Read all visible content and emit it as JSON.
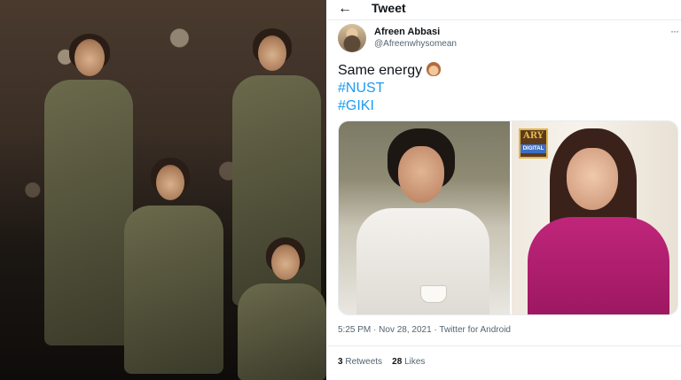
{
  "header": {
    "back_icon": "←",
    "title": "Tweet"
  },
  "author": {
    "display_name": "Afreen Abbasi",
    "handle": "@Afreenwhysomean"
  },
  "more_icon": "···",
  "tweet": {
    "text": "Same energy",
    "emoji": "see-no-evil-monkey",
    "hashtags": [
      "#NUST",
      "#GIKI"
    ]
  },
  "media": {
    "logo": {
      "line1": "ARY",
      "line2": "DIGITAL"
    }
  },
  "meta": {
    "time": "5:25 PM",
    "separator1": "·",
    "date": "Nov 28, 2021",
    "separator2": "·",
    "source": "Twitter for Android"
  },
  "stats": {
    "retweets_count": "3",
    "retweets_label": "Retweets",
    "likes_count": "28",
    "likes_label": "Likes"
  },
  "colors": {
    "link": "#1d9bf0",
    "text": "#0f1419",
    "secondary": "#536471"
  }
}
